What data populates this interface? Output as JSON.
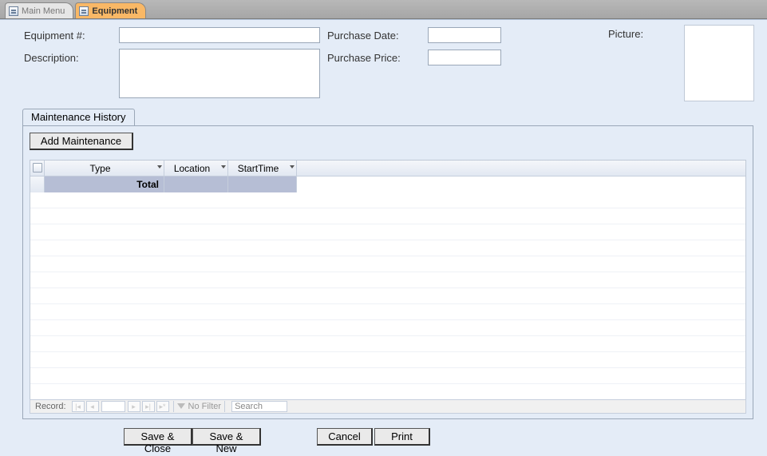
{
  "tabs": {
    "main_menu": "Main Menu",
    "equipment": "Equipment"
  },
  "form": {
    "equipment_no_label": "Equipment #:",
    "equipment_no_value": "",
    "description_label": "Description:",
    "description_value": "",
    "purchase_date_label": "Purchase Date:",
    "purchase_date_value": "",
    "purchase_price_label": "Purchase Price:",
    "purchase_price_value": "",
    "picture_label": "Picture:"
  },
  "sub": {
    "tab_label": "Maintenance History",
    "add_btn": "Add Maintenance",
    "columns": {
      "type": "Type",
      "location": "Location",
      "starttime": "StartTime"
    },
    "total_row_label": "Total",
    "recnav": {
      "label": "Record:",
      "filter": "No Filter",
      "search": "Search"
    }
  },
  "buttons": {
    "save_close": "Save & Close",
    "save_new": "Save & New",
    "cancel": "Cancel",
    "print": "Print"
  }
}
